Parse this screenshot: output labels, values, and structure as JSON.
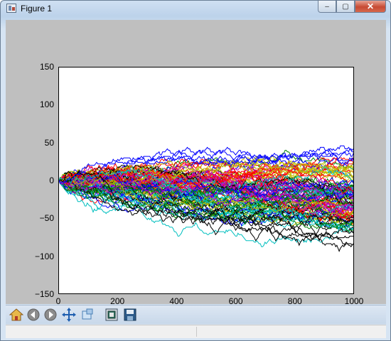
{
  "window": {
    "title": "Figure 1",
    "min_symbol": "‒",
    "max_symbol": "▢",
    "close_symbol": "✕"
  },
  "toolbar": {
    "tools": [
      {
        "name": "home-icon",
        "icon": "home"
      },
      {
        "name": "back-icon",
        "icon": "back"
      },
      {
        "name": "forward-icon",
        "icon": "forward"
      },
      {
        "name": "pan-icon",
        "icon": "pan"
      },
      {
        "name": "zoom-icon",
        "icon": "zoom"
      },
      {
        "name": "configure-subplots-icon",
        "icon": "subplots"
      },
      {
        "name": "save-icon",
        "icon": "save"
      }
    ]
  },
  "chart_data": {
    "type": "line",
    "title": "",
    "xlabel": "",
    "ylabel": "",
    "xlim": [
      0,
      1000
    ],
    "ylim": [
      -150,
      150
    ],
    "xticks": [
      "0",
      "200",
      "400",
      "600",
      "800",
      "1000"
    ],
    "yticks": [
      "150",
      "100",
      "50",
      "0",
      "−50",
      "−100",
      "−150"
    ],
    "grid": false,
    "description_note": "",
    "series_generator": {
      "kind": "random_walk",
      "n_series": 120,
      "n_steps": 1000,
      "start": 0,
      "step_choices": [
        -1,
        1
      ]
    },
    "colors": [
      "#0000ff",
      "#008000",
      "#ff0000",
      "#00bfbf",
      "#bf00bf",
      "#bfbf00",
      "#000000"
    ]
  }
}
